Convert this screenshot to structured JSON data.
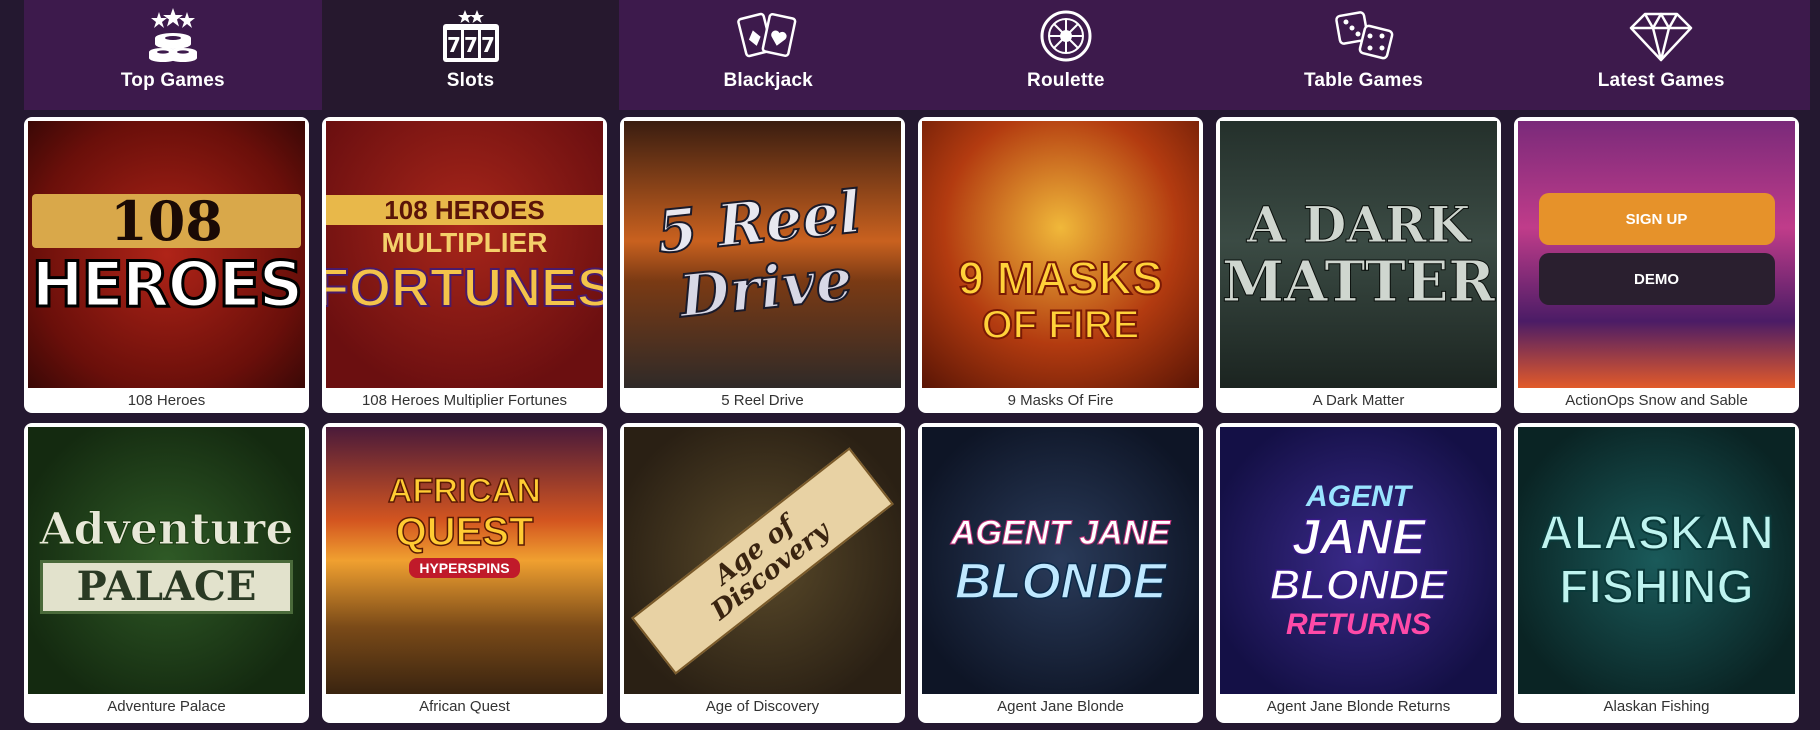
{
  "nav": {
    "items": [
      {
        "label": "Top Games",
        "icon": "stars-chips-icon"
      },
      {
        "label": "Slots",
        "icon": "slot-777-icon"
      },
      {
        "label": "Blackjack",
        "icon": "playing-cards-icon"
      },
      {
        "label": "Roulette",
        "icon": "roulette-wheel-icon"
      },
      {
        "label": "Table Games",
        "icon": "dice-icon"
      },
      {
        "label": "Latest Games",
        "icon": "diamond-icon"
      }
    ],
    "active_index": 1
  },
  "games": [
    {
      "title": "108 Heroes",
      "art": [
        "108",
        "HEROES"
      ]
    },
    {
      "title": "108 Heroes Multiplier Fortunes",
      "art": [
        "108 HEROES",
        "MULTIPLIER",
        "FORTUNES"
      ]
    },
    {
      "title": "5 Reel Drive",
      "art": [
        "5 Reel",
        "Drive"
      ]
    },
    {
      "title": "9 Masks Of Fire",
      "art": [
        "9 MASKS",
        "OF FIRE"
      ]
    },
    {
      "title": "A Dark Matter",
      "art": [
        "A DARK",
        "MATTER"
      ]
    },
    {
      "title": "ActionOps Snow and Sable",
      "art": []
    },
    {
      "title": "Adventure Palace",
      "art": [
        "Adventure",
        "PALACE"
      ]
    },
    {
      "title": "African Quest",
      "art": [
        "AFRICAN",
        "QUEST",
        "HYPERSPINS"
      ]
    },
    {
      "title": "Age of Discovery",
      "art": [
        "Age of Discovery"
      ]
    },
    {
      "title": "Agent Jane Blonde",
      "art": [
        "AGENT JANE",
        "BLONDE"
      ]
    },
    {
      "title": "Agent Jane Blonde Returns",
      "art": [
        "AGENT",
        "JANE",
        "BLONDE",
        "RETURNS"
      ]
    },
    {
      "title": "Alaskan Fishing",
      "art": [
        "ALASKAN",
        "FISHING"
      ]
    }
  ],
  "hover_overlay": {
    "signup_label": "SIGN UP",
    "demo_label": "DEMO"
  },
  "colors": {
    "nav_bg": "#3d1a4c",
    "nav_active_bg": "#26182e",
    "page_bg": "#241830",
    "signup_button": "#e6922a",
    "demo_button": "#2a1f2f"
  }
}
